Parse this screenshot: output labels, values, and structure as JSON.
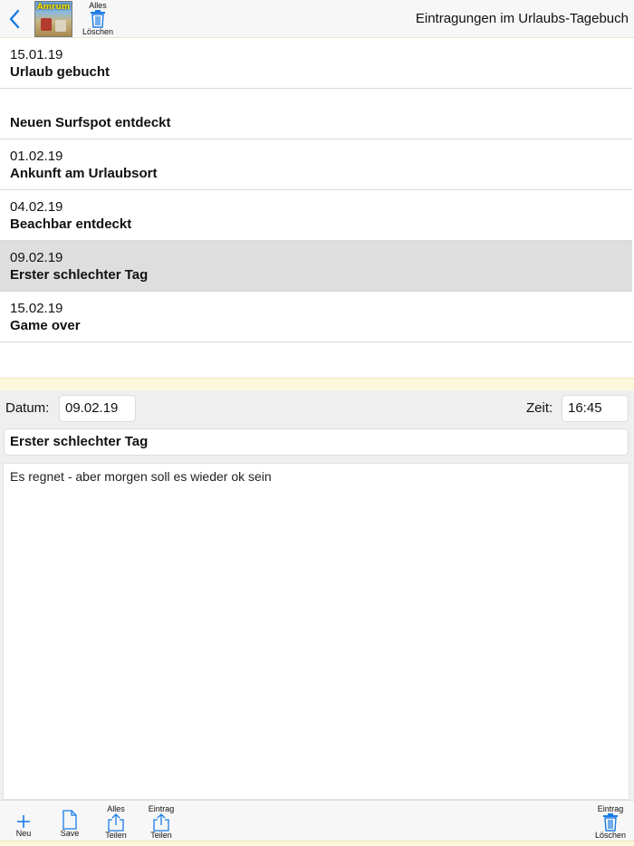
{
  "navbar": {
    "title": "Eintragungen im Urlaubs-Tagebuch",
    "thumbnail_label": "Amrum",
    "delete_all": {
      "top": "Alles",
      "bottom": "Löschen"
    }
  },
  "entries": [
    {
      "date": "15.01.19",
      "title": "Urlaub gebucht",
      "selected": false
    },
    {
      "date": "",
      "title": "Neuen Surfspot entdeckt",
      "selected": false
    },
    {
      "date": "01.02.19",
      "title": "Ankunft am Urlaubsort",
      "selected": false
    },
    {
      "date": "04.02.19",
      "title": "Beachbar entdeckt",
      "selected": false
    },
    {
      "date": "09.02.19",
      "title": "Erster schlechter Tag",
      "selected": true
    },
    {
      "date": "15.02.19",
      "title": "Game over",
      "selected": false
    }
  ],
  "detail": {
    "date_label": "Datum:",
    "date_value": "09.02.19",
    "time_label": "Zeit:",
    "time_value": "16:45",
    "title_value": "Erster schlechter Tag",
    "notes_value": "Es regnet - aber morgen soll es wieder ok sein"
  },
  "toolbar": {
    "new_label": "Neu",
    "save_label": "Save",
    "share_all": {
      "top": "Alles",
      "bottom": "Teilen"
    },
    "share_entry": {
      "top": "Eintrag",
      "bottom": "Teilen"
    },
    "delete_entry": {
      "top": "Eintrag",
      "bottom": "Löschen"
    }
  },
  "colors": {
    "accent": "#1a7be6",
    "selected_row": "#dedede",
    "divider": "#fbf8dc"
  }
}
